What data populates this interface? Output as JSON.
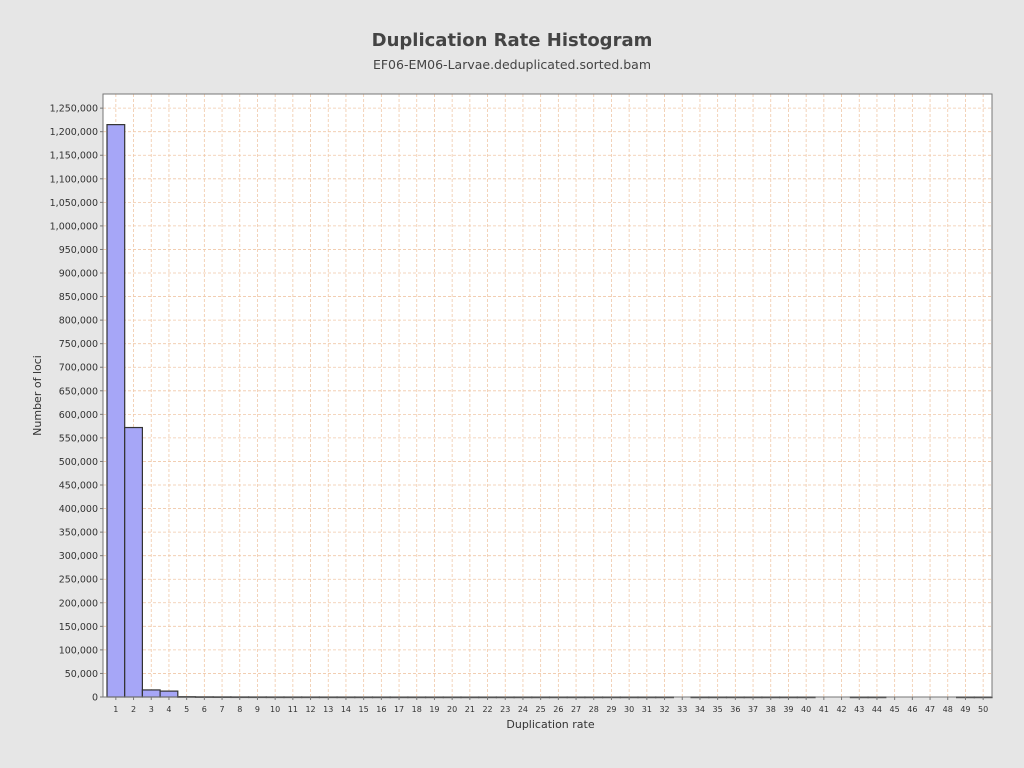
{
  "chart_data": {
    "type": "bar",
    "title": "Duplication Rate Histogram",
    "subtitle": "EF06-EM06-Larvae.deduplicated.sorted.bam",
    "xlabel": "Duplication rate",
    "ylabel": "Number of loci",
    "ylim": [
      0,
      1280000
    ],
    "y_tick_step": 50000,
    "grid": true,
    "legend": "none",
    "bar_color": "#a6a6f7",
    "bar_edge_color": "#333333",
    "grid_color": "#f0c8a8",
    "plot_background": "#ffffff",
    "categories": [
      "1",
      "2",
      "3",
      "4",
      "5",
      "6",
      "7",
      "8",
      "9",
      "10",
      "11",
      "12",
      "13",
      "14",
      "15",
      "16",
      "17",
      "18",
      "19",
      "20",
      "21",
      "22",
      "23",
      "24",
      "25",
      "26",
      "27",
      "28",
      "29",
      "30",
      "31",
      "32",
      "33",
      "34",
      "35",
      "36",
      "37",
      "38",
      "39",
      "40",
      "41",
      "42",
      "43",
      "44",
      "45",
      "46",
      "47",
      "48",
      "49",
      "50"
    ],
    "values": [
      1215000,
      572000,
      15000,
      12500,
      800,
      500,
      400,
      300,
      250,
      200,
      180,
      160,
      140,
      120,
      110,
      100,
      90,
      80,
      70,
      60,
      55,
      50,
      45,
      40,
      38,
      35,
      32,
      30,
      28,
      25,
      22,
      20,
      0,
      18,
      16,
      15,
      14,
      13,
      12,
      11,
      0,
      0,
      10,
      9,
      0,
      0,
      0,
      0,
      8,
      7
    ]
  }
}
